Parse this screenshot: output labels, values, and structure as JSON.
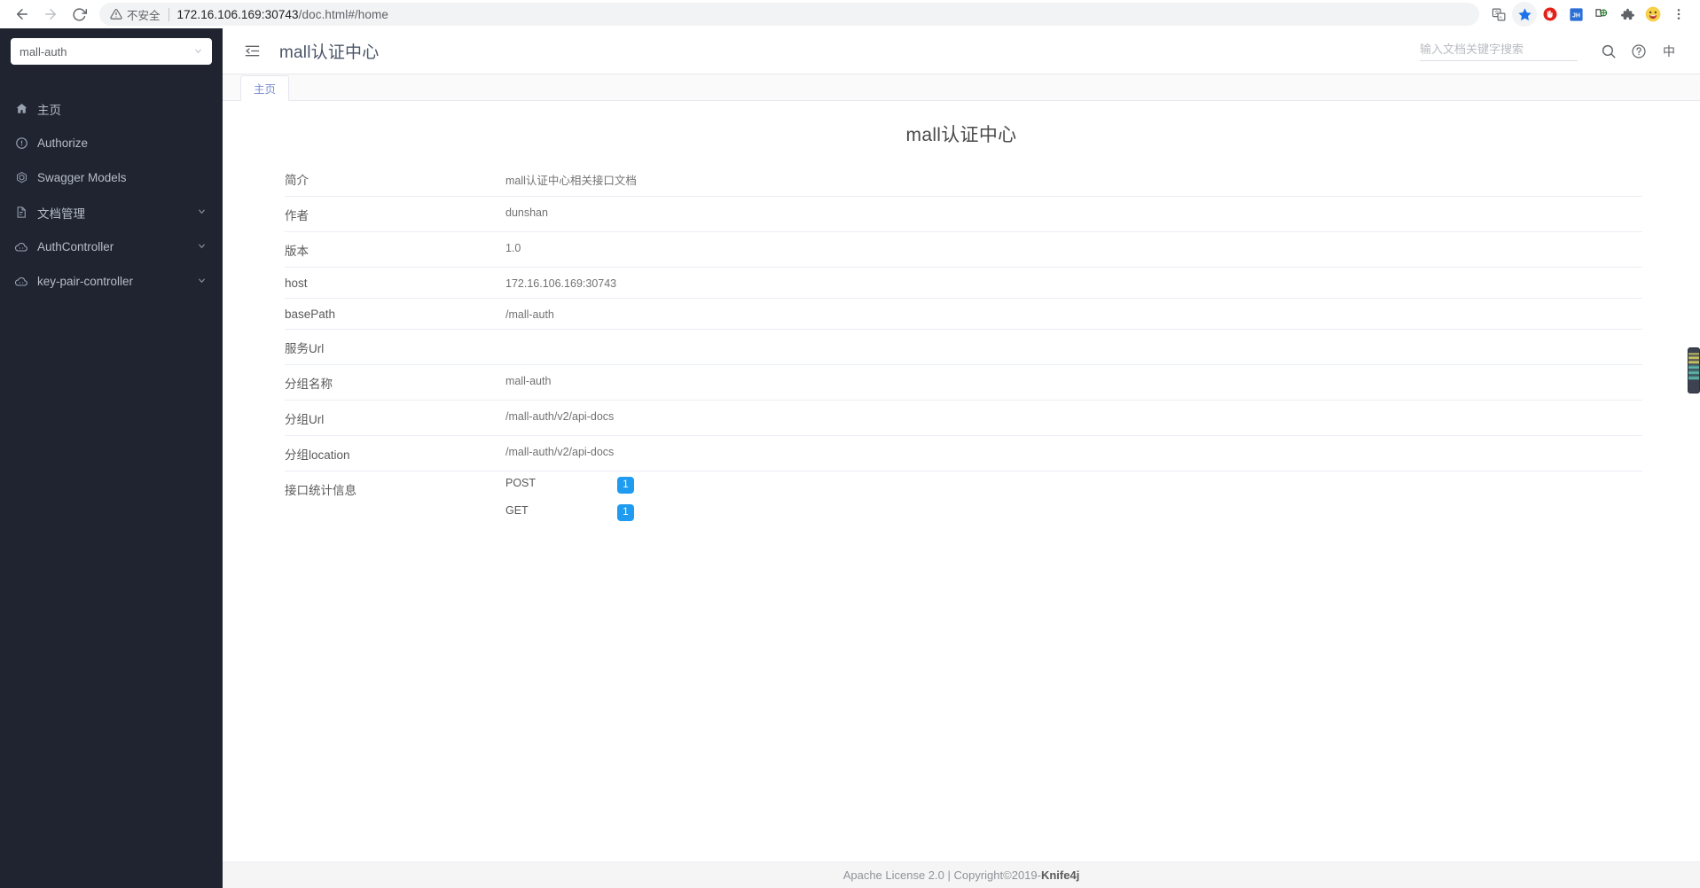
{
  "browser": {
    "security_label": "不安全",
    "url_host": "172.16.106.169:30743",
    "url_path": "/doc.html#/home",
    "nav": {
      "back": "back-button",
      "forward": "forward-button",
      "reload": "reload-button"
    },
    "toolbar_icons": [
      "translate-icon",
      "bookmark-star-icon",
      "adblock-icon",
      "jh-extension-icon",
      "screenshot-extension-icon",
      "extensions-puzzle-icon",
      "profile-avatar-icon",
      "chrome-menu-icon"
    ]
  },
  "sidebar": {
    "service_select": {
      "value": "mall-auth",
      "caret": "chevron-down-icon"
    },
    "items": [
      {
        "label": "主页",
        "icon": "home-icon",
        "expandable": false,
        "active": true
      },
      {
        "label": "Authorize",
        "icon": "lock-icon",
        "expandable": false,
        "active": false
      },
      {
        "label": "Swagger Models",
        "icon": "model-icon",
        "expandable": false,
        "active": false
      },
      {
        "label": "文档管理",
        "icon": "document-icon",
        "expandable": true,
        "active": false
      },
      {
        "label": "AuthController",
        "icon": "cloud-icon",
        "expandable": true,
        "active": false
      },
      {
        "label": "key-pair-controller",
        "icon": "cloud-icon",
        "expandable": true,
        "active": false
      }
    ],
    "arrow_glyph": "⌄"
  },
  "topbar": {
    "collapse_icon": "collapse-menu-icon",
    "title": "mall认证中心",
    "search_placeholder": "输入文档关键字搜索",
    "search_value": "",
    "search_icon": "search-icon",
    "help_icon": "help-circle-icon",
    "lang_toggle": "中"
  },
  "tabs": [
    {
      "label": "主页",
      "active": true
    }
  ],
  "doc": {
    "title": "mall认证中心",
    "rows": [
      {
        "key": "简介",
        "value": "mall认证中心相关接口文档"
      },
      {
        "key": "作者",
        "value": "dunshan"
      },
      {
        "key": "版本",
        "value": "1.0"
      },
      {
        "key": "host",
        "value": "172.16.106.169:30743"
      },
      {
        "key": "basePath",
        "value": "/mall-auth"
      },
      {
        "key": "服务Url",
        "value": ""
      },
      {
        "key": "分组名称",
        "value": "mall-auth"
      },
      {
        "key": "分组Url",
        "value": "/mall-auth/v2/api-docs"
      },
      {
        "key": "分组location",
        "value": "/mall-auth/v2/api-docs"
      }
    ],
    "stats_key": "接口统计信息",
    "stats": [
      {
        "method": "POST",
        "count": "1"
      },
      {
        "method": "GET",
        "count": "1"
      }
    ]
  },
  "footer": {
    "license": "Apache License 2.0 | Copyright ",
    "copyright_symbol": "©",
    "year": " 2019-",
    "brand": "Knife4j"
  },
  "colors": {
    "sidebar_bg": "#1f2430",
    "badge_blue": "#1f9bf0",
    "tab_active_text": "#7a8bd4",
    "accent": "#409eff"
  }
}
